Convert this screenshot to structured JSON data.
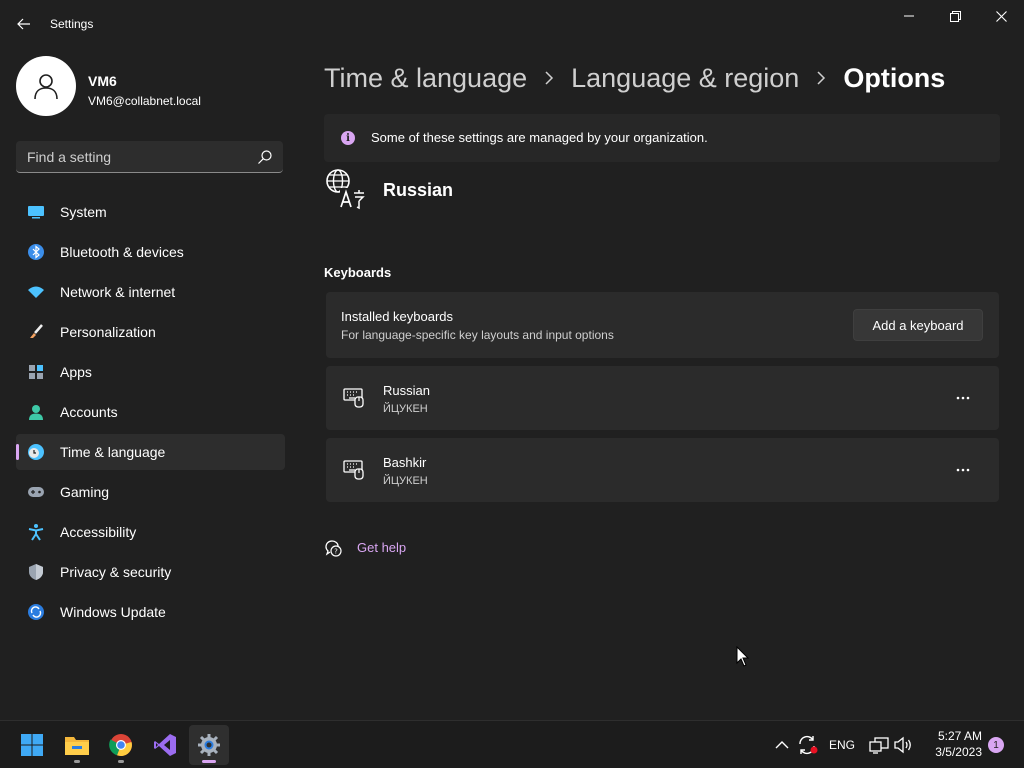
{
  "window": {
    "title": "Settings",
    "controls": {
      "minimize": "minimize-icon",
      "maximize": "restore-icon",
      "close": "close-icon"
    }
  },
  "user": {
    "name": "VM6",
    "email": "VM6@collabnet.local"
  },
  "search": {
    "placeholder": "Find a setting",
    "value": ""
  },
  "sidebar": {
    "items": [
      {
        "label": "System",
        "icon": "system-icon"
      },
      {
        "label": "Bluetooth & devices",
        "icon": "bluetooth-icon"
      },
      {
        "label": "Network & internet",
        "icon": "wifi-icon"
      },
      {
        "label": "Personalization",
        "icon": "brush-icon"
      },
      {
        "label": "Apps",
        "icon": "apps-icon"
      },
      {
        "label": "Accounts",
        "icon": "accounts-icon"
      },
      {
        "label": "Time & language",
        "icon": "clock-globe-icon",
        "active": true
      },
      {
        "label": "Gaming",
        "icon": "gamepad-icon"
      },
      {
        "label": "Accessibility",
        "icon": "accessibility-icon"
      },
      {
        "label": "Privacy & security",
        "icon": "shield-icon"
      },
      {
        "label": "Windows Update",
        "icon": "update-icon"
      }
    ]
  },
  "breadcrumb": [
    "Time & language",
    "Language & region",
    "Options"
  ],
  "info_bar": {
    "text": "Some of these settings are managed by your organization.",
    "icon": "i"
  },
  "language": {
    "name": "Russian",
    "icon": "language-icon"
  },
  "keyboards": {
    "section_label": "Keyboards",
    "installed": {
      "title": "Installed keyboards",
      "subtitle": "For language-specific key layouts and input options",
      "add_button": "Add a keyboard"
    },
    "list": [
      {
        "name": "Russian",
        "layout": "ЙЦУКЕН"
      },
      {
        "name": "Bashkir",
        "layout": "ЙЦУКЕН"
      }
    ],
    "more_label": "···"
  },
  "help": {
    "label": "Get help"
  },
  "taskbar": {
    "apps": [
      "windows-start-icon",
      "file-explorer-icon",
      "chrome-icon",
      "visual-studio-icon",
      "settings-icon"
    ],
    "tray": {
      "language": "ENG",
      "time": "5:27 AM",
      "date": "3/5/2023",
      "notification_count": "1"
    }
  },
  "colors": {
    "background": "#202020",
    "card": "#2b2b2b",
    "accent": "#d9a6f2",
    "text": "#ffffff",
    "secondary_text": "#cfcfcf"
  }
}
